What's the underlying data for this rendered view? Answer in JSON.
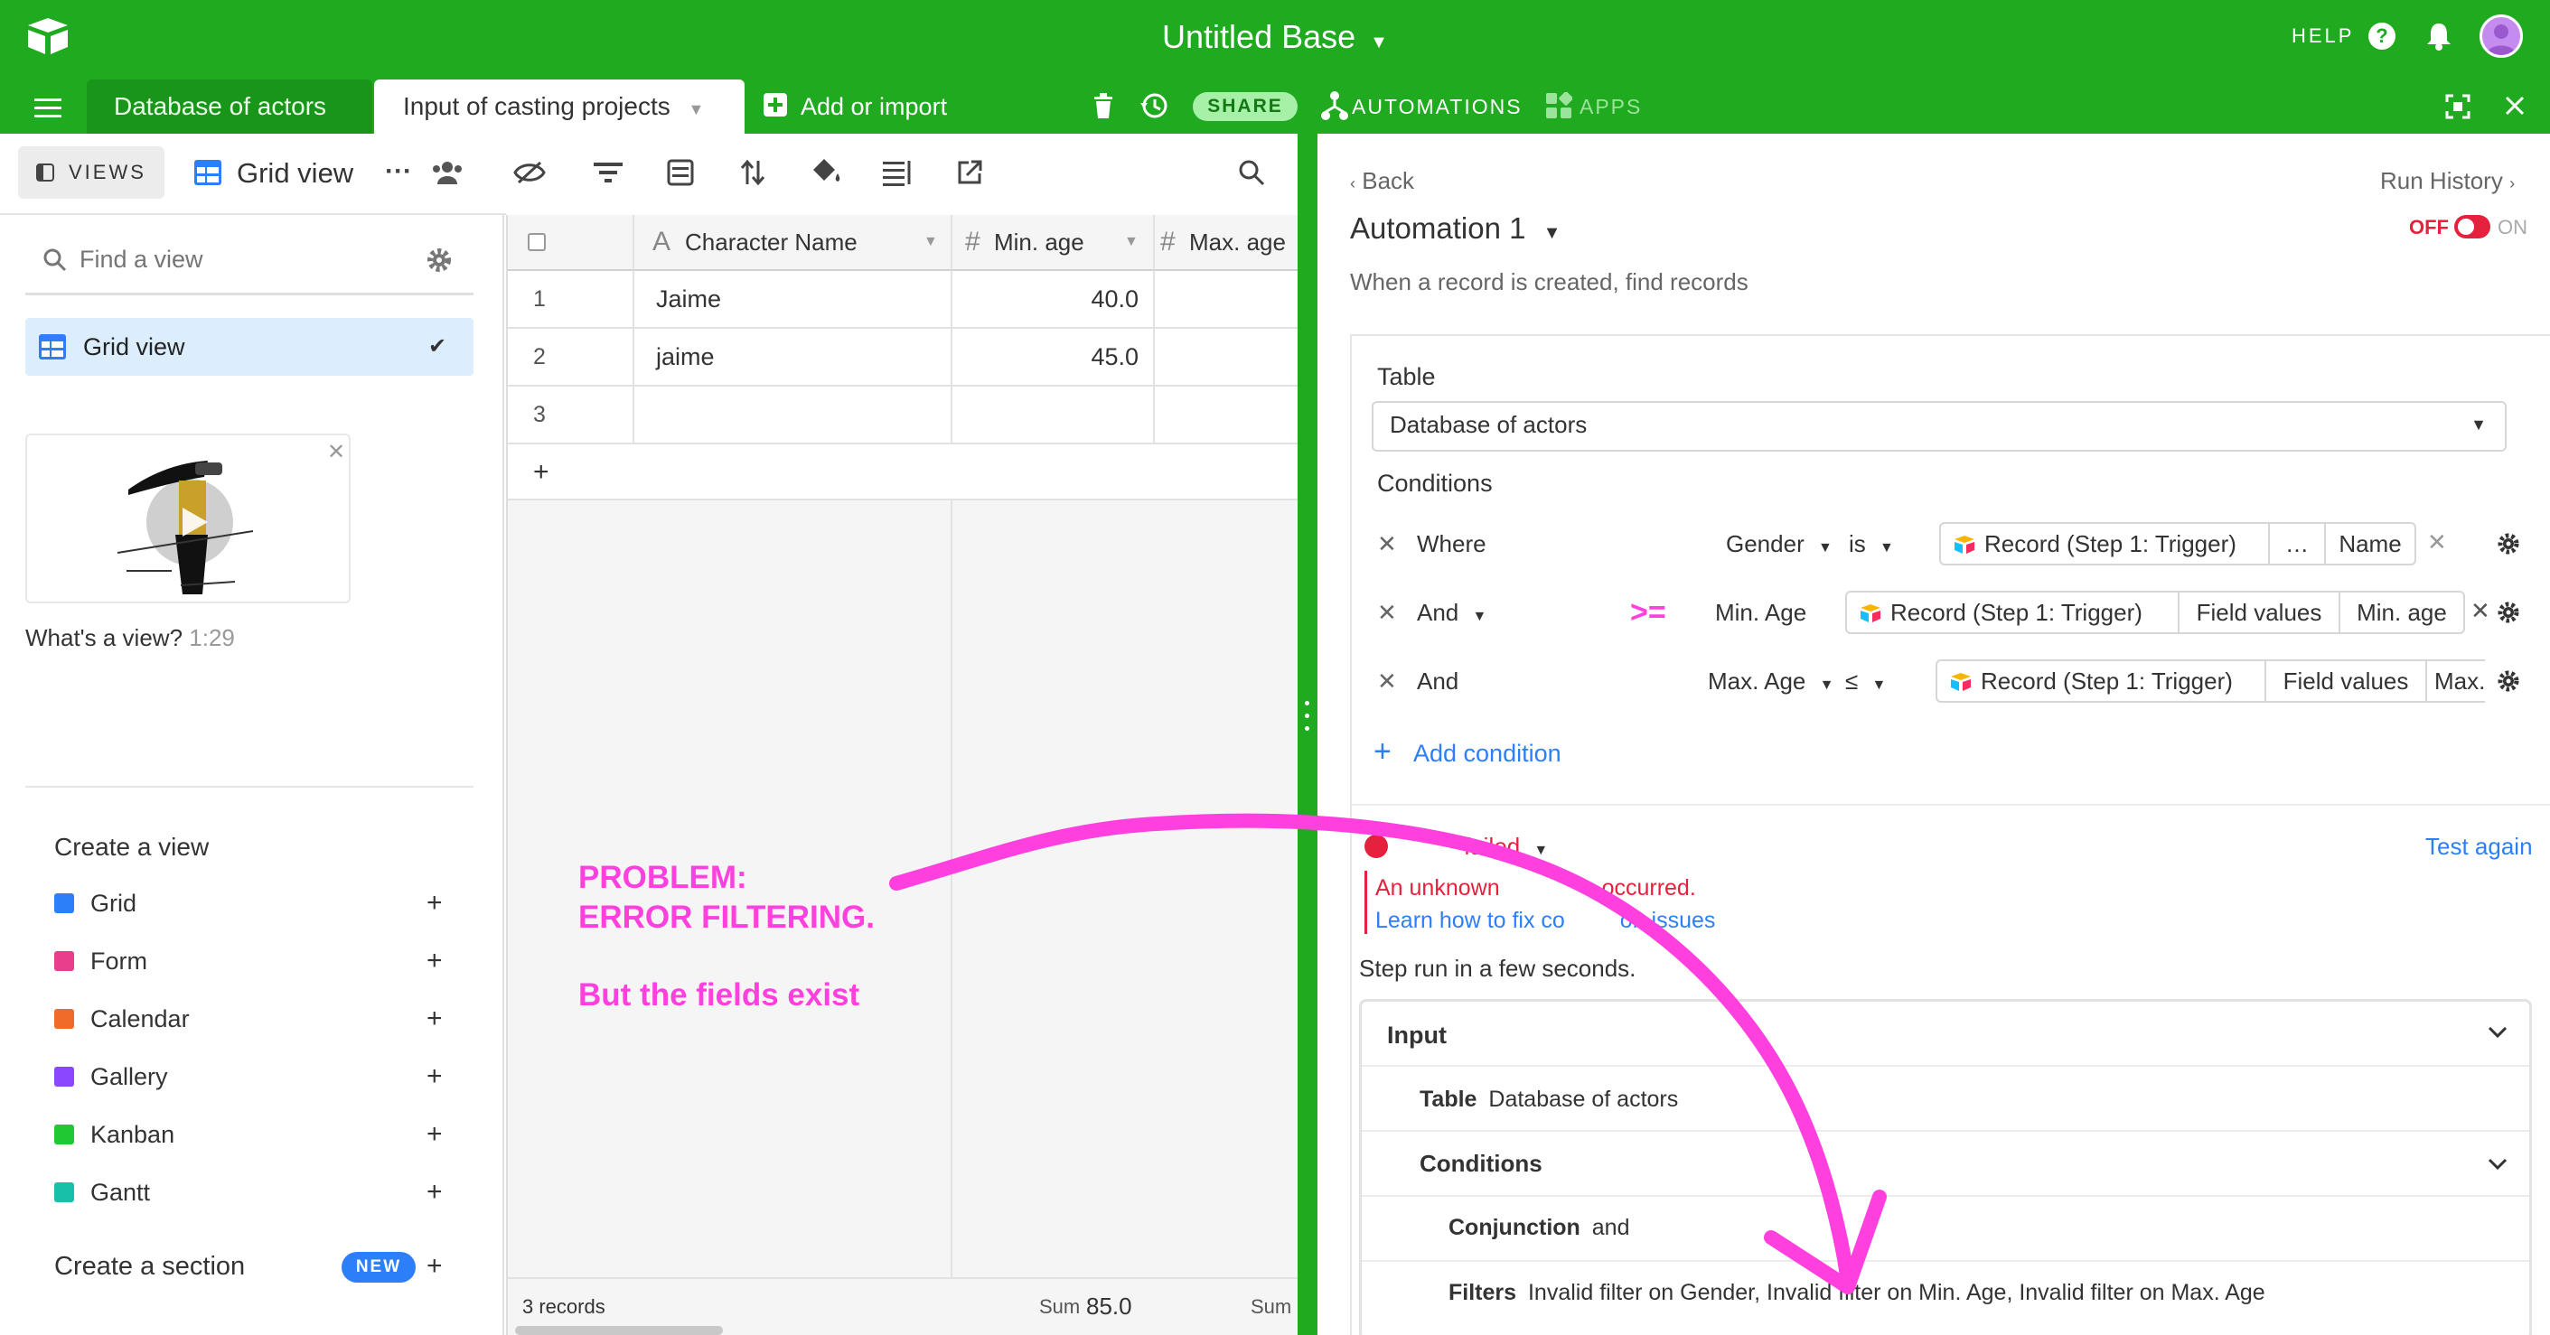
{
  "app": {
    "title": "Untitled Base",
    "help_label": "HELP",
    "tabs": [
      {
        "label": "Database of actors"
      },
      {
        "label": "Input of casting projects"
      }
    ],
    "add_or_import": "Add or import",
    "share_label": "SHARE",
    "automations_label": "AUTOMATIONS",
    "apps_label": "APPS",
    "brand_green": "#1faa1f"
  },
  "views_toolbar": {
    "views_label": "VIEWS",
    "current_view": "Grid view"
  },
  "sidebar": {
    "find_placeholder": "Find a view",
    "views": [
      {
        "label": "Grid view"
      }
    ],
    "video_caption": "What's a view?",
    "video_duration": "1:29",
    "create_view_title": "Create a view",
    "create_items": [
      {
        "label": "Grid",
        "color": "#2d7ff9"
      },
      {
        "label": "Form",
        "color": "#e83e8c"
      },
      {
        "label": "Calendar",
        "color": "#f06a2a"
      },
      {
        "label": "Gallery",
        "color": "#8b46ff"
      },
      {
        "label": "Kanban",
        "color": "#20c933"
      },
      {
        "label": "Gantt",
        "color": "#18bfa9"
      }
    ],
    "create_section": "Create a section",
    "new_badge": "NEW"
  },
  "grid": {
    "columns": [
      "Character Name",
      "Min. age",
      "Max. age"
    ],
    "rows": [
      {
        "num": "1",
        "name": "Jaime",
        "min_age": "40.0"
      },
      {
        "num": "2",
        "name": "jaime",
        "min_age": "45.0"
      },
      {
        "num": "3",
        "name": "",
        "min_age": ""
      }
    ],
    "add_row": "+",
    "footer_count": "3 records",
    "sum_label": "Sum",
    "sum_value": "85.0",
    "sum_label2": "Sum"
  },
  "annotation": {
    "line1": "PROBLEM:",
    "line2": "ERROR FILTERING.",
    "line3": "But the fields exist",
    "ge_symbol": ">=",
    "color": "#ff3fde"
  },
  "automation": {
    "back_label": "Back",
    "run_history": "Run History",
    "name": "Automation 1",
    "toggle_off": "OFF",
    "toggle_on": "ON",
    "description": "When a record is created, find records",
    "table_label": "Table",
    "table_value": "Database of actors",
    "conditions_label": "Conditions",
    "conditions": [
      {
        "prefix": "Where",
        "field": "Gender",
        "op": "is",
        "source": "Record (Step 1: Trigger)",
        "extra": "…",
        "value": "Name"
      },
      {
        "prefix": "And",
        "field": "Min. Age",
        "op": "",
        "source": "Record (Step 1: Trigger)",
        "extra": "Field values",
        "value": "Min. age"
      },
      {
        "prefix": "And",
        "field": "Max. Age",
        "op": "≤",
        "source": "Record (Step 1: Trigger)",
        "extra": "Field values",
        "value": "Max."
      }
    ],
    "add_condition": "Add condition",
    "test_status": "failed",
    "test_again": "Test again",
    "error_line1": "An unknown",
    "error_line1b": "occurred.",
    "error_line2": "Learn how to fix co",
    "error_line2b": "on issues",
    "step_run": "Step run in a few seconds.",
    "input_title": "Input",
    "input_table_key": "Table",
    "input_table_val": "Database of actors",
    "input_conditions": "Conditions",
    "conjunction_key": "Conjunction",
    "conjunction_val": "and",
    "filters_key": "Filters",
    "filters_val": "Invalid filter on Gender, Invalid filter on Min. Age, Invalid filter on Max. Age"
  }
}
